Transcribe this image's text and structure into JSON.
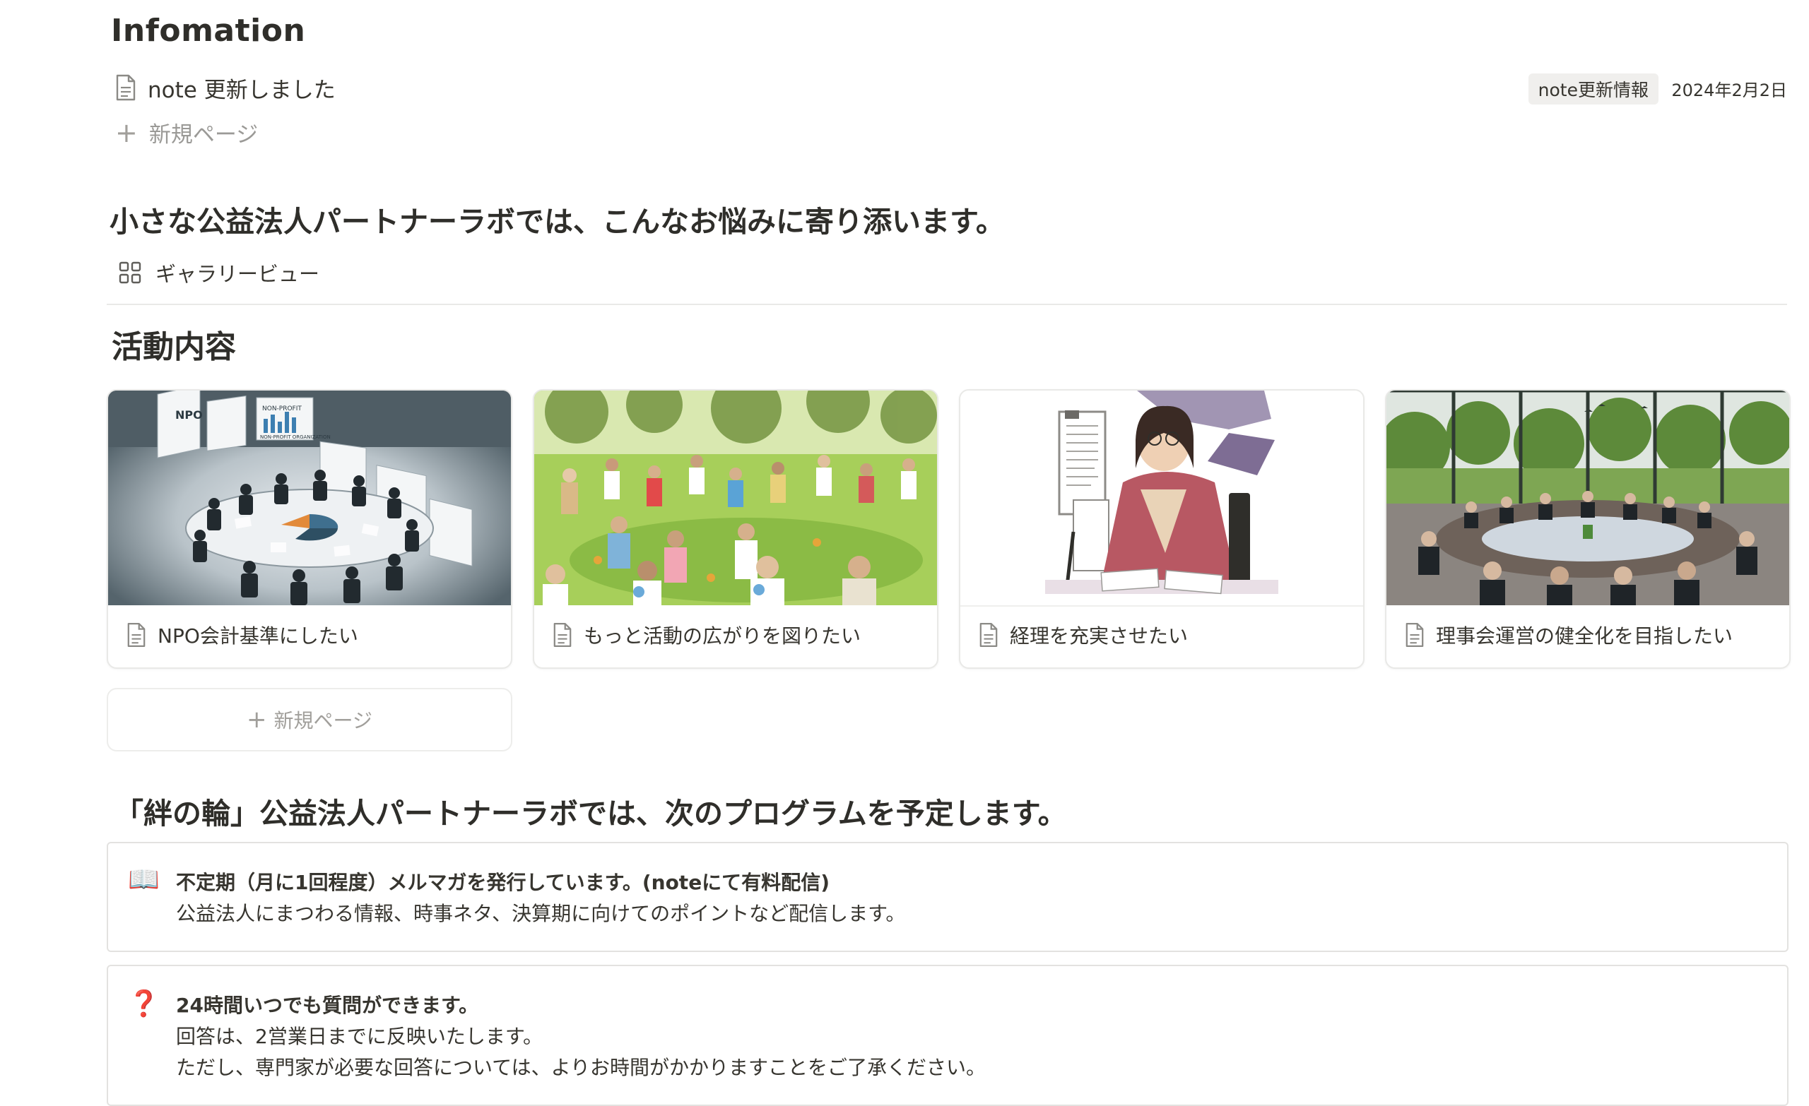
{
  "info": {
    "heading": "Infomation",
    "note_title": "note 更新しました",
    "note_tag": "note更新情報",
    "note_date": "2024年2月2日",
    "new_page": "新規ページ"
  },
  "lead": {
    "heading": "小さな公益法人パートナーラボでは、こんなお悩みに寄り添います。",
    "view_label": "ギャラリービュー"
  },
  "activities": {
    "heading": "活動内容",
    "cards": [
      {
        "title": "NPO会計基準にしたい",
        "img_texts": [
          "NPO",
          "NON-PROFIT",
          "NON-PROFIT ORGANIZATION"
        ]
      },
      {
        "title": "もっと活動の広がりを図りたい"
      },
      {
        "title": "経理を充実させたい"
      },
      {
        "title": "理事会運営の健全化を目指したい"
      }
    ],
    "new_page": "新規ページ"
  },
  "program": {
    "heading": "「絆の輪」公益法人パートナーラボでは、次のプログラムを予定します。",
    "callouts": [
      {
        "icon": "📖",
        "icon_name": "open-book-icon",
        "title": "不定期（月に1回程度）メルマガを発行しています。(noteにて有料配信)",
        "lines": [
          "公益法人にまつわる情報、時事ネタ、決算期に向けてのポイントなど配信します。"
        ]
      },
      {
        "icon": "❓",
        "icon_name": "question-mark-icon",
        "title": "24時間いつでも質問ができます。",
        "lines": [
          "回答は、2営業日までに反映いたします。",
          "ただし、専門家が必要な回答については、よりお時間がかかりますことをご了承ください。"
        ]
      }
    ]
  },
  "colors": {
    "text": "#37352f",
    "muted": "#9b9a97",
    "border": "#e9e9e7",
    "tag_bg": "#f0efed",
    "question": "#d44c47"
  }
}
